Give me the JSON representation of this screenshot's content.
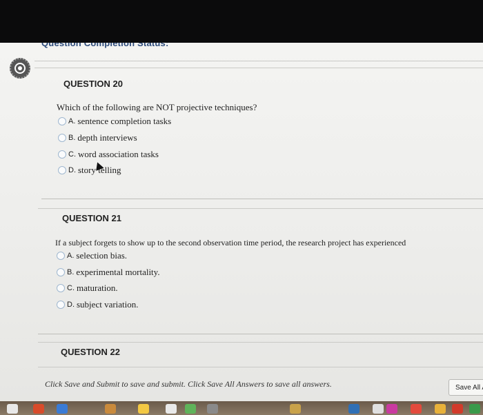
{
  "header": {
    "completion_status": "Question Completion Status:"
  },
  "questions": [
    {
      "title": "QUESTION 20",
      "text": "Which of the following are NOT projective techniques?",
      "options": [
        {
          "letter": "A.",
          "text": "sentence completion tasks"
        },
        {
          "letter": "B.",
          "text": "depth interviews"
        },
        {
          "letter": "C.",
          "text": "word association tasks"
        },
        {
          "letter": "D.",
          "text": "story telling"
        }
      ]
    },
    {
      "title": "QUESTION 21",
      "text": "If a subject forgets to show up to the second observation time period, the research project has experienced",
      "options": [
        {
          "letter": "A.",
          "text": "selection bias."
        },
        {
          "letter": "B.",
          "text": "experimental mortality."
        },
        {
          "letter": "C.",
          "text": "maturation."
        },
        {
          "letter": "D.",
          "text": "subject variation."
        }
      ]
    },
    {
      "title": "QUESTION 22"
    }
  ],
  "footer": {
    "note": "Click Save and Submit to save and submit. Click Save All Answers to save all answers.",
    "save_all_label": "Save All Answers"
  },
  "dock_colors": [
    "#e8e8e8",
    "#d84b2a",
    "#3a7bd5",
    "#c98a3c",
    "#f3c843",
    "#e9e9e9",
    "#5fb35a",
    "#8a8a8a",
    "#c9a24a",
    "#2f6fb5",
    "#e0e0e0",
    "#c93aa0",
    "#e34a3c",
    "#e8b13a",
    "#d23a2a",
    "#3a9a4a"
  ]
}
